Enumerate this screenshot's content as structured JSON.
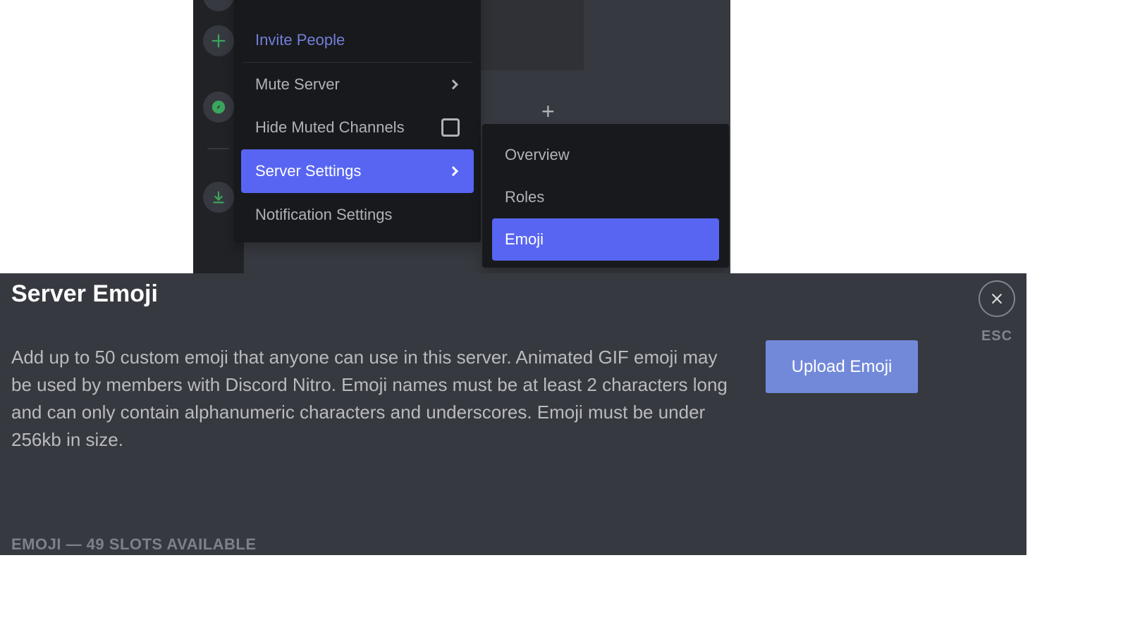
{
  "colors": {
    "blurple": "#5865F2",
    "button_blurple": "#7289DA",
    "green": "#3BA55D"
  },
  "server_menu": {
    "invite_label": "Invite People",
    "mute_label": "Mute Server",
    "hide_label": "Hide Muted Channels",
    "settings_label": "Server Settings",
    "notifications_label": "Notification Settings"
  },
  "settings_submenu": {
    "overview_label": "Overview",
    "roles_label": "Roles",
    "emoji_label": "Emoji"
  },
  "emoji_page": {
    "title": "Server Emoji",
    "description": "Add up to 50 custom emoji that anyone can use in this server. Animated GIF emoji may be used by members with Discord Nitro. Emoji names must be at least 2 characters long and can only contain alphanumeric characters and underscores. Emoji must be under 256kb in size.",
    "upload_label": "Upload Emoji",
    "esc_label": "ESC",
    "slots_label": "EMOJI — 49 SLOTS AVAILABLE"
  }
}
